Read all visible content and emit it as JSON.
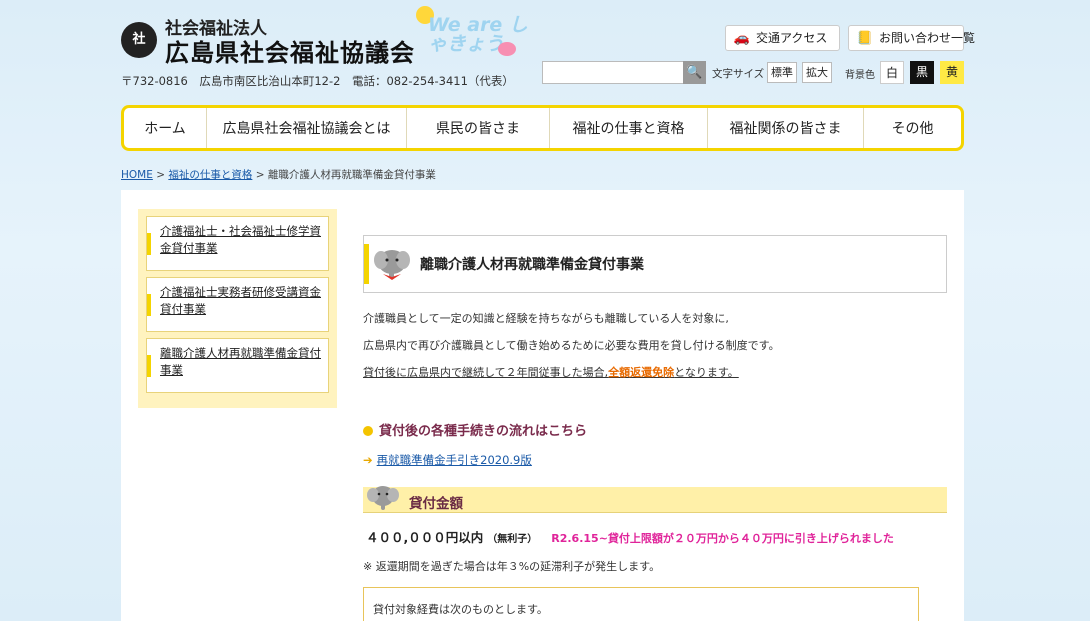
{
  "header": {
    "org_type": "社会福祉法人",
    "org_name": "広島県社会福祉協議会",
    "logo_mark": "社",
    "badge_text": "We are しゃきょう",
    "address": "〒732-0816　広島市南区比治山本町12-2　電話：082-254-3411（代表）",
    "access_label": "交通アクセス",
    "contact_label": "お問い合わせ一覧",
    "search": {
      "placeholder": "",
      "value": "",
      "button_icon": "search-icon"
    },
    "font_size_label": "文字サイズ",
    "font_size_standard": "標準",
    "font_size_large": "拡大",
    "bg_color_label": "背景色",
    "bg_white": "白",
    "bg_black": "黒",
    "bg_yellow": "黄"
  },
  "nav": {
    "items": [
      {
        "label": "ホーム"
      },
      {
        "label": "広島県社会福祉協議会とは"
      },
      {
        "label": "県民の皆さま"
      },
      {
        "label": "福祉の仕事と資格"
      },
      {
        "label": "福祉関係の皆さま"
      },
      {
        "label": "その他"
      }
    ]
  },
  "breadcrumb": {
    "home": "HOME",
    "sep": ">",
    "parent": "福祉の仕事と資格",
    "current": "離職介護人材再就職準備金貸付事業"
  },
  "sidebar": {
    "items": [
      {
        "label": "介護福祉士・社会福祉士修学資金貸付事業"
      },
      {
        "label": "介護福祉士実務者研修受講資金貸付事業"
      },
      {
        "label": "離職介護人材再就職準備金貸付事業"
      }
    ]
  },
  "main": {
    "title": "離職介護人材再就職準備金貸付事業",
    "para1": "介護職員として一定の知識と経験を持ちながらも離職している人を対象に,",
    "para2": "広島県内で再び介護職員として働き始めるために必要な費用を貸し付ける制度です。",
    "para3_before": "貸付後に広島県内で継続して２年間従事した場合,",
    "para3_highlight": "全額返還免除",
    "para3_after": "となります。",
    "flow_heading": "貸付後の各種手続きの流れはこちら",
    "guide_link": "再就職準備金手引き2020.9版",
    "section_title": "貸付金額",
    "amount": "４００,０００円以内",
    "amount_note": "（無利子）",
    "amount_update": "R2.6.15~貸付上限額が２０万円から４０万円に引き上げられました",
    "late_note": "※ 返還期間を過ぎた場合は年３%の延滞利子が発生します。",
    "expense_text": "貸付対象経費は次のものとします。"
  },
  "colors": {
    "accent_yellow": "#f4d400",
    "link_blue": "#1a5aa8",
    "heading_maroon": "#7a2b4c",
    "highlight_orange": "#e86a00",
    "update_pink": "#e0249a"
  }
}
